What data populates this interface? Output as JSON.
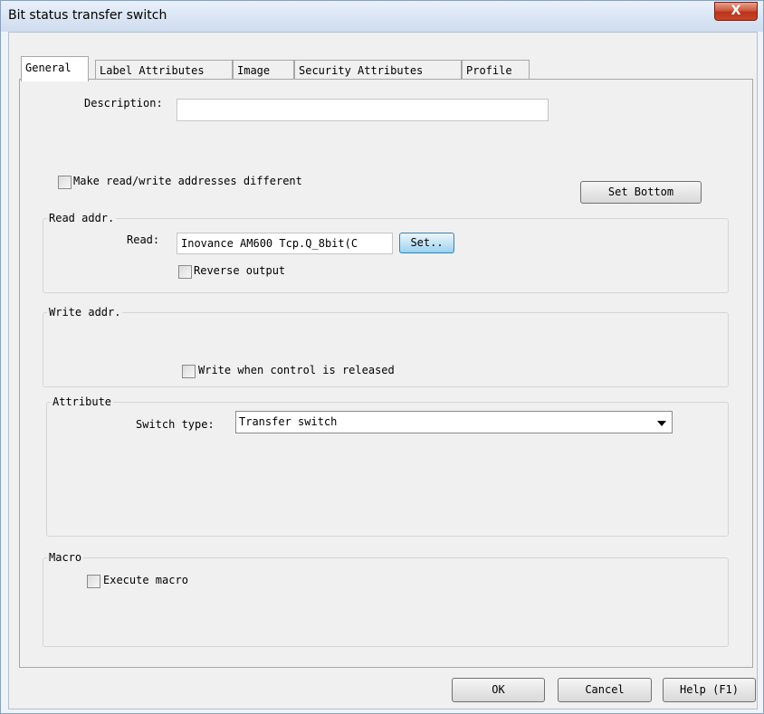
{
  "window": {
    "title": "Bit status transfer switch",
    "close_glyph": "X"
  },
  "tabs": [
    {
      "label": "General"
    },
    {
      "label": "Label Attributes"
    },
    {
      "label": "Image"
    },
    {
      "label": "Security Attributes"
    },
    {
      "label": "Profile"
    }
  ],
  "general": {
    "description_label": "Description:",
    "description_value": "",
    "make_different_label": "Make read/write addresses different",
    "set_bottom_label": "Set Bottom",
    "read_group": {
      "title": "Read addr.",
      "read_label": "Read:",
      "read_value": "Inovance AM600 Tcp.Q_8bit(C",
      "set_label": "Set..",
      "reverse_label": "Reverse output"
    },
    "write_group": {
      "title": "Write addr.",
      "release_label": "Write when control is released"
    },
    "attribute_group": {
      "title": "Attribute",
      "switch_type_label": "Switch type:",
      "switch_type_value": "Transfer switch"
    },
    "macro_group": {
      "title": "Macro",
      "execute_label": "Execute macro"
    }
  },
  "footer": {
    "ok_label": "OK",
    "cancel_label": "Cancel",
    "help_label": "Help (F1)"
  },
  "colors": {
    "close_button": "#c9462a",
    "set_button": "#98d1ef",
    "dialog_background": "#f0f0f0"
  }
}
